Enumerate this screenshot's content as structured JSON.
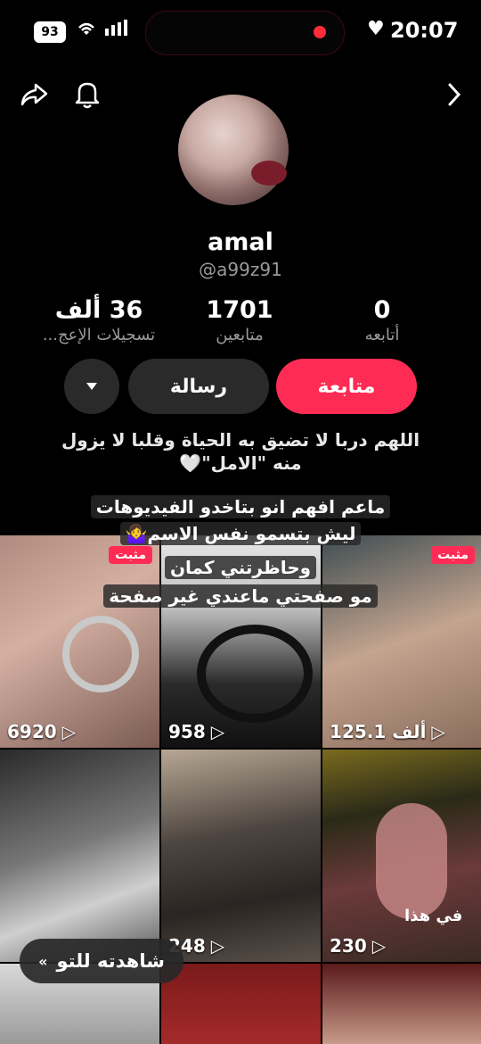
{
  "status_bar": {
    "battery": "93",
    "time": "20:07",
    "icons": [
      "wifi-icon",
      "signal-icon",
      "record-dot-icon",
      "heart-icon"
    ]
  },
  "nav": {
    "icons": [
      "share-icon",
      "bell-icon",
      "chevron-right-icon"
    ]
  },
  "profile": {
    "name": "amal",
    "handle": "@a99z91",
    "stats": [
      {
        "number": "36 ألف",
        "label": "تسجيلات الإعج..."
      },
      {
        "number": "1701",
        "label": "متابعين"
      },
      {
        "number": "0",
        "label": "أتابعه"
      }
    ],
    "buttons": {
      "follow": "متابعة",
      "message": "رسالة",
      "more_icon": "caret-down-icon"
    },
    "bio_line1": "اللهم دربا لا تضيق به الحياة وقلبا لا يزول",
    "bio_line2": "منه \"الامل\"🤍"
  },
  "overlay": {
    "line1": "ماعم افهم انو بتاخدو الفيديوهات",
    "line2": "ليش بتسمو نفس الاسم🤷‍♀️",
    "line3": "وحاظرتني كمان",
    "line4": "مو صفحتي ماعندي غير صفحة"
  },
  "videos": [
    {
      "count": "6920",
      "pinned": "مثبت"
    },
    {
      "count": "958",
      "pinned": ""
    },
    {
      "count": "125.1 ألف",
      "pinned": "مثبت"
    },
    {
      "count": "",
      "pinned": ""
    },
    {
      "count": "248",
      "pinned": ""
    },
    {
      "count": "230",
      "pinned": "",
      "caption": "في هذا"
    }
  ],
  "watched_button": "شاهدته للتو",
  "colors": {
    "accent": "#fe2c55",
    "secondary_button": "#2a2a2a"
  }
}
